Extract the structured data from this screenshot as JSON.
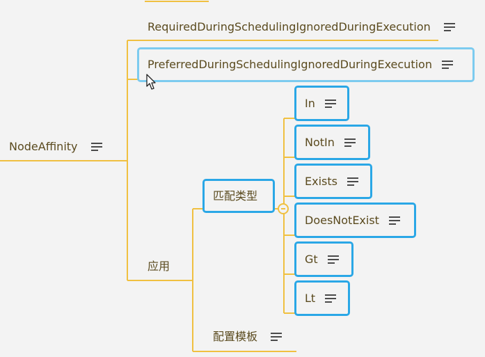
{
  "root": {
    "label": "NodeAffinity"
  },
  "branch_required": {
    "label": "RequiredDuringSchedulingIgnoredDuringExecution"
  },
  "branch_preferred": {
    "label": "PreferredDuringSchedulingIgnoredDuringExecution"
  },
  "branch_apply": {
    "label": "应用"
  },
  "match_type": {
    "label": "匹配类型"
  },
  "config_template": {
    "label": "配置模板"
  },
  "operators": [
    {
      "label": "In"
    },
    {
      "label": "NotIn"
    },
    {
      "label": "Exists"
    },
    {
      "label": "DoesNotExist"
    },
    {
      "label": "Gt"
    },
    {
      "label": "Lt"
    }
  ],
  "colors": {
    "connector": "#f0c040",
    "selection": "#2aa7e6",
    "text": "#5a4a1e",
    "background": "#f3f3f3"
  }
}
